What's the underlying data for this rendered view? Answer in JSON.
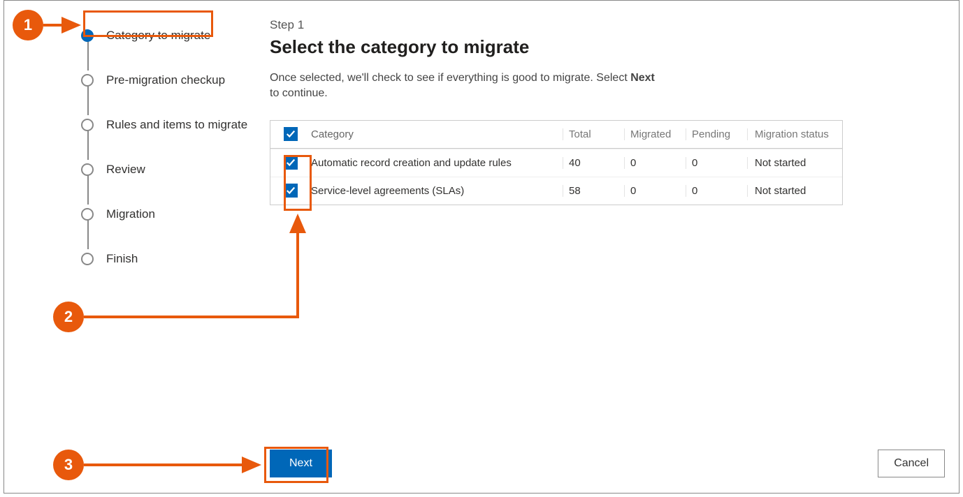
{
  "sidebar": {
    "steps": [
      {
        "label": "Category to migrate",
        "active": true
      },
      {
        "label": "Pre-migration checkup",
        "active": false
      },
      {
        "label": "Rules and items to migrate",
        "active": false
      },
      {
        "label": "Review",
        "active": false
      },
      {
        "label": "Migration",
        "active": false
      },
      {
        "label": "Finish",
        "active": false
      }
    ]
  },
  "main": {
    "step_label": "Step 1",
    "title": "Select the category to migrate",
    "desc_pre": "Once selected, we'll check to see if everything is good to migrate. Select ",
    "desc_bold": "Next",
    "desc_post": " to continue.",
    "table": {
      "headers": {
        "category": "Category",
        "total": "Total",
        "migrated": "Migrated",
        "pending": "Pending",
        "status": "Migration status"
      },
      "rows": [
        {
          "category": "Automatic record creation and update rules",
          "total": "40",
          "migrated": "0",
          "pending": "0",
          "status": "Not started",
          "checked": true
        },
        {
          "category": "Service-level agreements (SLAs)",
          "total": "58",
          "migrated": "0",
          "pending": "0",
          "status": "Not started",
          "checked": true
        }
      ]
    }
  },
  "footer": {
    "next": "Next",
    "cancel": "Cancel"
  },
  "annotations": {
    "c1": "1",
    "c2": "2",
    "c3": "3"
  }
}
